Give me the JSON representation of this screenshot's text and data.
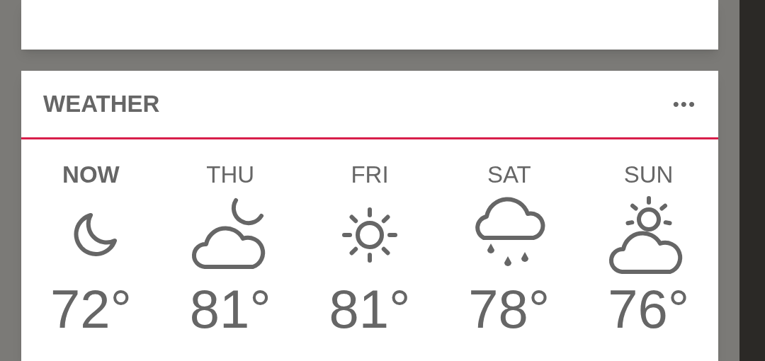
{
  "weather": {
    "title": "WEATHER",
    "menu": "•••",
    "days": [
      {
        "label": "NOW",
        "selected": true,
        "kind": "moon",
        "temp": "72°"
      },
      {
        "label": "THU",
        "selected": false,
        "kind": "cloud-moon",
        "temp": "81°"
      },
      {
        "label": "FRI",
        "selected": false,
        "kind": "sun",
        "temp": "81°"
      },
      {
        "label": "SAT",
        "selected": false,
        "kind": "rain",
        "temp": "78°"
      },
      {
        "label": "SUN",
        "selected": false,
        "kind": "cloud-sun",
        "temp": "76°"
      }
    ]
  }
}
